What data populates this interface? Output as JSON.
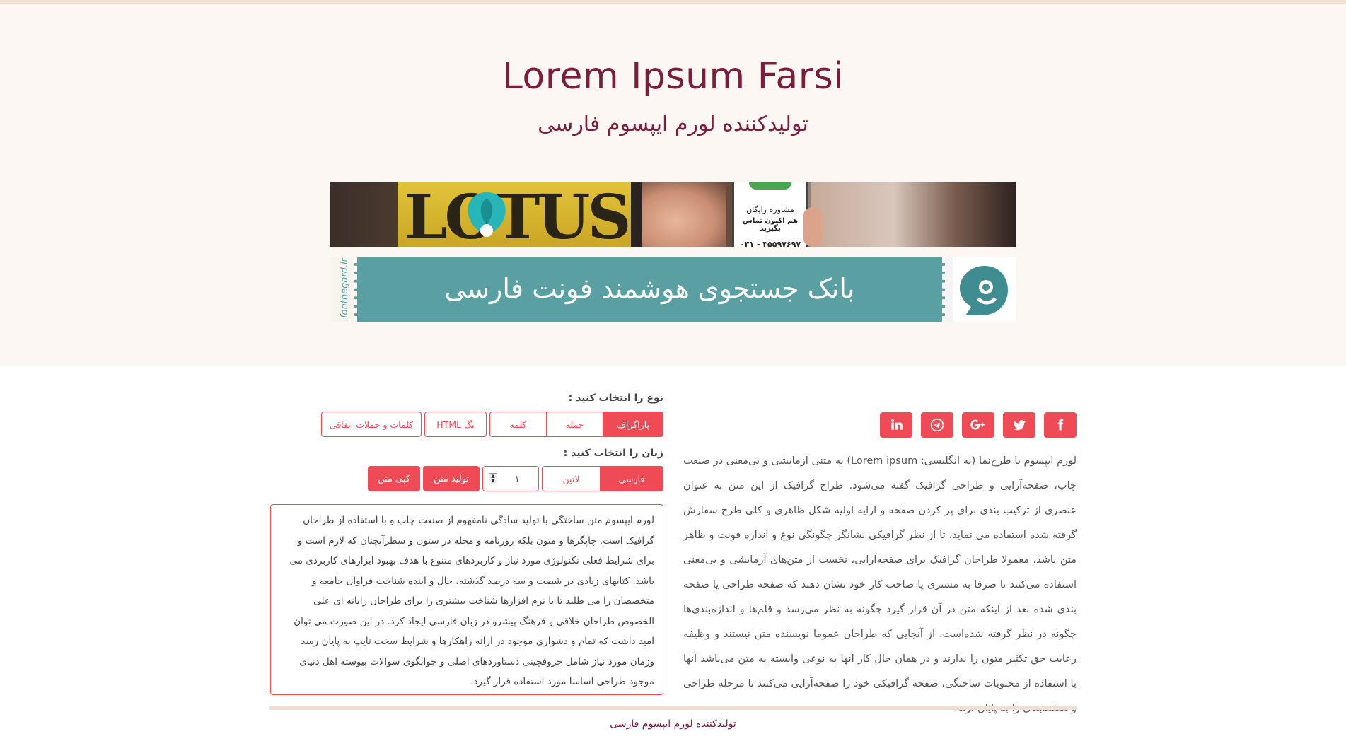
{
  "header": {
    "title": "Lorem Ipsum Farsi",
    "subtitle": "تولیدکننده لورم ایپسوم فارسی"
  },
  "banner1": {
    "brand": "LOTUS",
    "card_line1": "مشاوره رایگان",
    "card_line2": "هم اکنون تماس بگیرید",
    "card_phone": "۰۳۱ - ۳۵۵۹۷۶۹۷"
  },
  "banner2": {
    "side_text": "fontbegard.ir",
    "main_text": "بانک جستجوی هوشمند فونت فارسی"
  },
  "social": [
    {
      "name": "facebook-icon"
    },
    {
      "name": "twitter-icon"
    },
    {
      "name": "google-plus-icon"
    },
    {
      "name": "telegram-icon"
    },
    {
      "name": "linkedin-icon"
    }
  ],
  "article": "لورم ایپسوم یا طرح‌نما (به انگلیسی: Lorem ipsum) به متنی آزمایشی و بی‌معنی در صنعت چاپ، صفحه‌آرایی و طراحی گرافیک گفته می‌شود. طراح گرافیک از این متن به عنوان عنصری از ترکیب بندی برای پر کردن صفحه و ارایه اولیه شکل ظاهری و کلی طرح سفارش گرفته شده استفاده می نماید، تا از نظر گرافیکی نشانگر چگونگی نوع و اندازه فونت و ظاهر متن باشد. معمولا طراحان گرافیک برای صفحه‌آرایی، نخست از متن‌های آزمایشی و بی‌معنی استفاده می‌کنند تا صرفا به مشتری یا صاحب کار خود نشان دهند که صفحه طراحی یا صفحه بندی شده بعد از اینکه متن در آن قرار گیرد چگونه به نظر می‌رسد و قلم‌ها و اندازه‌بندی‌ها چگونه در نظر گرفته شده‌است. از آنجایی که طراحان عموما نویسنده متن نیستند و وظیفه رعایت حق تکثیر متون را ندارند و در همان حال کار آنها به نوعی وابسته به متن می‌باشد آنها با استفاده از محتویات ساختگی، صفحه گرافیکی خود را صفحه‌آرایی می‌کنند تا مرحله طراحی و صفحه‌بندی را به پایان برند.",
  "controls": {
    "type_label": "نوع را انتخاب کنید :",
    "type_options": [
      "پاراگراف",
      "جمله",
      "کلمه",
      "تگ HTML",
      "کلمات و جملات اتفاقی"
    ],
    "type_selected": "پاراگراف",
    "lang_label": "زبان را انتخاب کنید :",
    "lang_options": [
      "فارسی",
      "لاتین"
    ],
    "lang_selected": "فارسی",
    "count_value": "۱",
    "generate_label": "تولید متن",
    "copy_label": "کپی متن"
  },
  "output_text": "لورم ایپسوم متن ساختگی با تولید سادگی نامفهوم از صنعت چاپ و با استفاده از طراحان گرافیک است. چاپگرها و متون بلکه روزنامه و مجله در ستون و سطرآنچنان که لازم است و برای شرایط فعلی تکنولوژی مورد نیاز و کاربردهای متنوع با هدف بهبود ابزارهای کاربردی می باشد. کتابهای زیادی در شصت و سه درصد گذشته، حال و آینده شناخت فراوان جامعه و متخصصان را می طلبد تا با نرم افزارها شناخت بیشتری را برای طراحان رایانه ای علی الخصوص طراحان خلاقی و فرهنگ پیشرو در زبان فارسی ایجاد کرد. در این صورت می توان امید داشت که تمام و دشواری موجود در ارائه راهکارها و شرایط سخت تایپ به پایان رسد وزمان مورد نیاز شامل حروفچینی دستاوردهای اصلی و جوابگوی سوالات پیوسته اهل دنیای موجود طراحی اساسا مورد استفاده قرار گیرد.",
  "footer": {
    "text": "تولیدکننده لورم ایپسوم فارسی"
  },
  "colors": {
    "accent": "#ef4b57",
    "title": "#7a1e3c",
    "header_bg": "#fdf7f3",
    "rule": "#f1e0cf"
  }
}
